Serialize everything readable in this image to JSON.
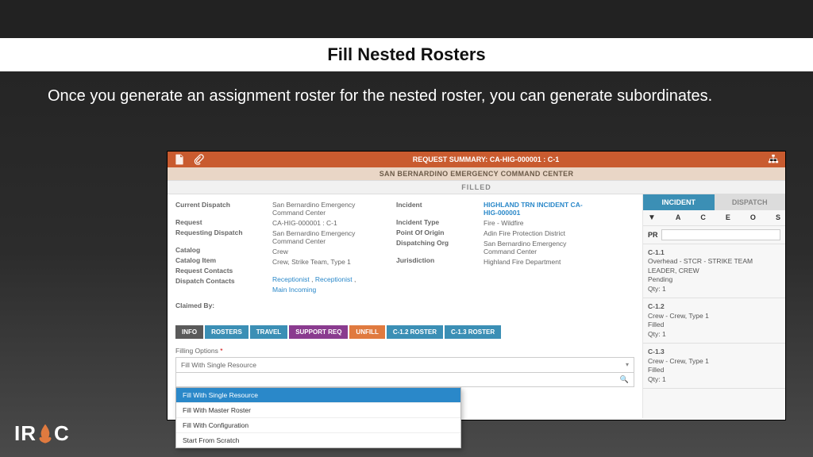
{
  "page": {
    "title": "Fill Nested Rosters",
    "subtitle": "Once you generate an assignment roster for the nested roster, you can generate subordinates."
  },
  "logo_text_left": "IR",
  "logo_text_right": "C",
  "header": {
    "title": "REQUEST SUMMARY: CA-HIG-000001 : C-1",
    "center_name": "SAN BERNARDINO EMERGENCY COMMAND CENTER",
    "status": "FILLED"
  },
  "details": {
    "left_labels": {
      "current_dispatch": "Current Dispatch",
      "request": "Request",
      "requesting_dispatch": "Requesting Dispatch",
      "catalog": "Catalog",
      "catalog_item": "Catalog Item",
      "request_contacts": "Request Contacts",
      "dispatch_contacts": "Dispatch Contacts",
      "claimed_by": "Claimed By:"
    },
    "left_values": {
      "current_dispatch": "San Bernardino Emergency Command Center",
      "request": "CA-HIG-000001 : C-1",
      "requesting_dispatch": "San Bernardino Emergency Command Center",
      "catalog": "Crew",
      "catalog_item": "Crew, Strike Team, Type 1",
      "dispatch_contacts_links": {
        "a": "Receptionist",
        "b": "Receptionist",
        "c": "Main Incoming"
      }
    },
    "right_labels": {
      "incident": "Incident",
      "incident_type": "Incident Type",
      "point_of_origin": "Point Of Origin",
      "dispatching_org": "Dispatching Org",
      "jurisdiction": "Jurisdiction"
    },
    "right_values": {
      "incident_link": "HIGHLAND TRN INCIDENT CA-HIG-000001",
      "incident_type": "Fire - Wildfire",
      "point_of_origin": "Adin Fire Protection District",
      "dispatching_org": "San Bernardino Emergency Command Center",
      "jurisdiction": "Highland Fire Department"
    }
  },
  "tabs": {
    "info": "INFO",
    "rosters": "ROSTERS",
    "travel": "TRAVEL",
    "support": "SUPPORT REQ",
    "unfill": "UNFILL",
    "r12": "C-1.2 ROSTER",
    "r13": "C-1.3 ROSTER"
  },
  "filling": {
    "label": "Filling Options",
    "asterisk": "*",
    "selected": "Fill With Single Resource",
    "options": {
      "o1": "Fill With Single Resource",
      "o2": "Fill With Master Roster",
      "o3": "Fill With Configuration",
      "o4": "Start From Scratch"
    }
  },
  "side": {
    "tabs": {
      "incident": "INCIDENT",
      "dispatch": "DISPATCH"
    },
    "letters": {
      "l0": "▼",
      "l1": "A",
      "l2": "C",
      "l3": "E",
      "l4": "O",
      "l5": "S"
    },
    "pr": "PR",
    "cards": {
      "c1": {
        "id": "C-1.1",
        "title": "Overhead - STCR - STRIKE TEAM LEADER, CREW",
        "status": "Pending",
        "qty": "Qty: 1"
      },
      "c2": {
        "id": "C-1.2",
        "title": "Crew - Crew, Type 1",
        "status": "Filled",
        "qty": "Qty: 1"
      },
      "c3": {
        "id": "C-1.3",
        "title": "Crew - Crew, Type 1",
        "status": "Filled",
        "qty": "Qty: 1"
      }
    }
  }
}
